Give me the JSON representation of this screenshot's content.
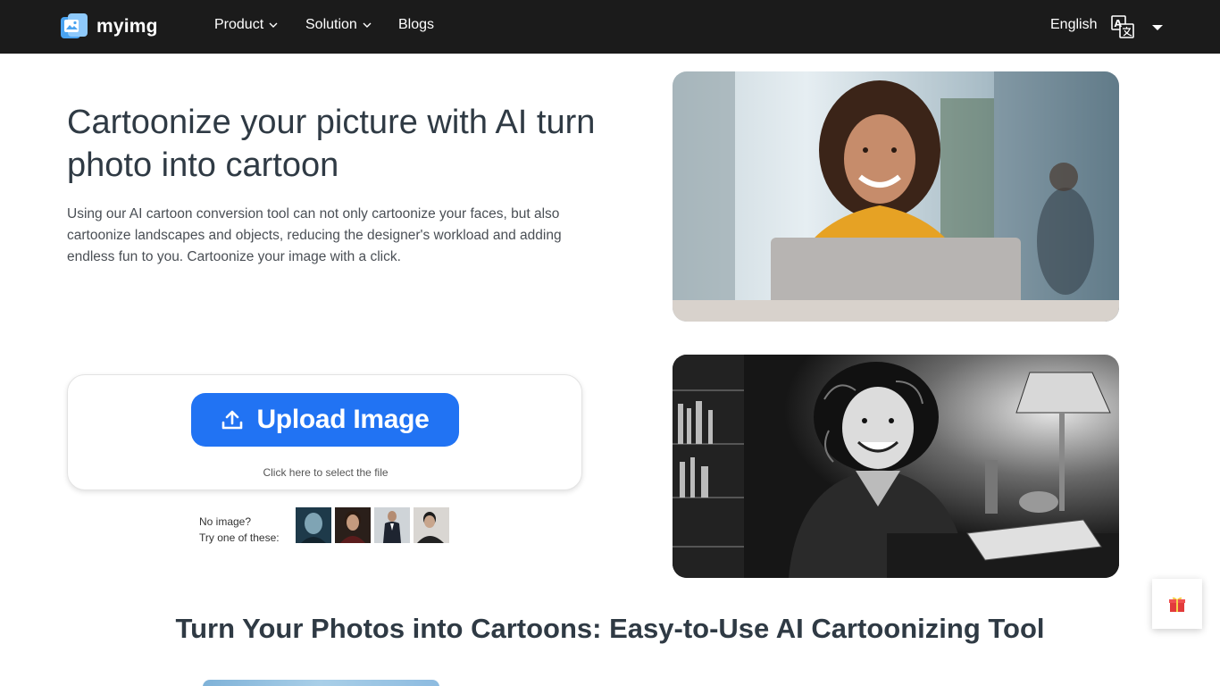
{
  "nav": {
    "logo_text": "myimg",
    "items": [
      {
        "label": "Product",
        "has_dropdown": true
      },
      {
        "label": "Solution",
        "has_dropdown": true
      },
      {
        "label": "Blogs",
        "has_dropdown": false
      }
    ],
    "language": "English",
    "language_icon": "translate-icon",
    "language_caret_icon": "caret-down-icon"
  },
  "hero": {
    "title": "Cartoonize your picture with AI turn photo into cartoon",
    "description": "Using our AI cartoon conversion tool can not only cartoonize your faces, but also cartoonize landscapes and objects, reducing the designer's workload and adding endless fun to you. Cartoonize your image with a click."
  },
  "upload": {
    "button_label": "Upload Image",
    "button_icon": "upload-icon",
    "hint": "Click here to select the file",
    "accent": "#2173f3"
  },
  "samples": {
    "line1": "No image?",
    "line2": "Try one of these:",
    "count": 4
  },
  "section": {
    "title": "Turn Your Photos into Cartoons: Easy-to-Use AI Cartoonizing Tool"
  },
  "floating": {
    "gift_icon": "gift-icon"
  },
  "colors": {
    "nav_bg": "#1b1b1b",
    "accent": "#2173f3",
    "heading": "#2f3a44"
  }
}
